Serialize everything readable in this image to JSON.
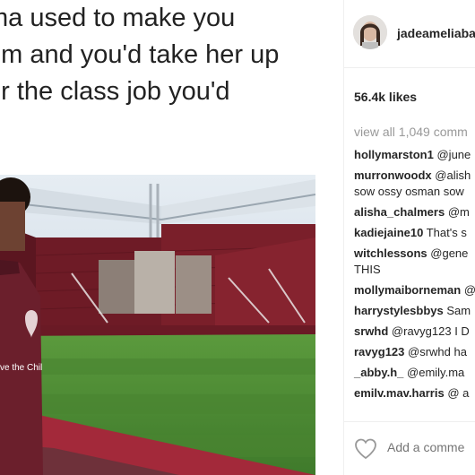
{
  "post": {
    "caption_lines": [
      "ma used to make you",
      "om and you'd take her up",
      "er the class job you'd"
    ],
    "jersey_text": "ve the Chil"
  },
  "header": {
    "username": "jadeameliaba"
  },
  "likes": "56.4k likes",
  "view_all": "view all 1,049 comm",
  "comments": [
    {
      "user": "hollymarston1",
      "text": "@june"
    },
    {
      "user": "murronwoodx",
      "text": "@alish"
    },
    {
      "user": "",
      "text": "sow ossy osman sow"
    },
    {
      "user": "alisha_chalmers",
      "text": "@m"
    },
    {
      "user": "kadiejaine10",
      "text": "That's s"
    },
    {
      "user": "witchlessons",
      "text": "@gene"
    },
    {
      "user": "",
      "text": "THIS"
    },
    {
      "user": "mollymaiborneman",
      "text": "@"
    },
    {
      "user": "harrystylesbbys",
      "text": "Sam"
    },
    {
      "user": "srwhd",
      "text": "@ravyg123 I D"
    },
    {
      "user": "ravyg123",
      "text": "@srwhd ha"
    },
    {
      "user": "_abby.h_",
      "text": "@emily.ma"
    },
    {
      "user": "emilv.mav.harris",
      "text": "@ a"
    }
  ],
  "add_comment": {
    "placeholder": "Add a comme"
  },
  "icons": {
    "like": "heart-icon"
  },
  "colors": {
    "username": "#262626",
    "muted": "#999999",
    "photo_sky": "#cdd9e5",
    "stadium_seat": "#7a1f2a",
    "pitch": "#4f8a35",
    "jersey": "#6b1f2c"
  }
}
